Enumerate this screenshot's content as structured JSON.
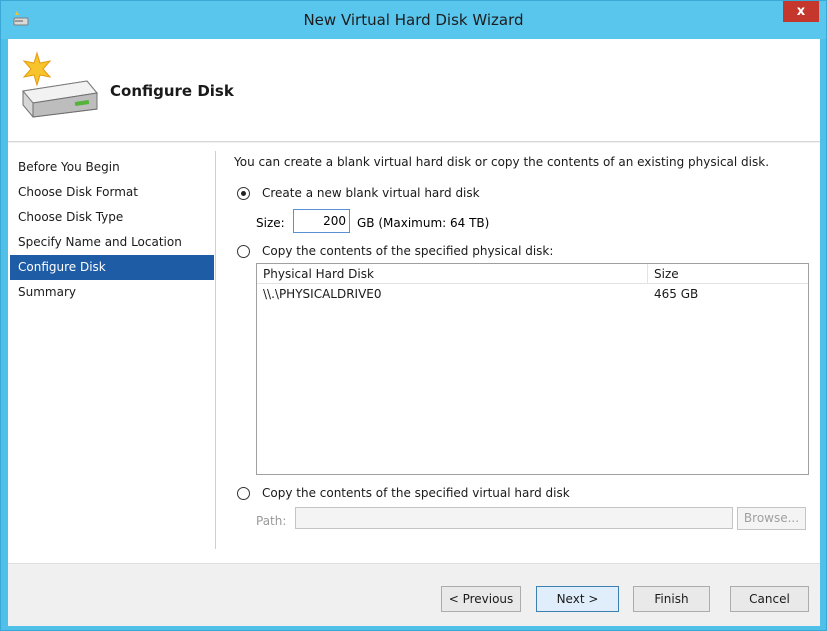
{
  "window": {
    "title": "New Virtual Hard Disk Wizard",
    "close_label": "x"
  },
  "header": {
    "title": "Configure Disk"
  },
  "steps": [
    {
      "label": "Before You Begin",
      "active": false
    },
    {
      "label": "Choose Disk Format",
      "active": false
    },
    {
      "label": "Choose Disk Type",
      "active": false
    },
    {
      "label": "Specify Name and Location",
      "active": false
    },
    {
      "label": "Configure Disk",
      "active": true
    },
    {
      "label": "Summary",
      "active": false
    }
  ],
  "main": {
    "intro": "You can create a blank virtual hard disk or copy the contents of an existing physical disk.",
    "option_new": {
      "label": "Create a new blank virtual hard disk",
      "selected": true,
      "size_label": "Size:",
      "size_value": "200",
      "size_unit": "GB (Maximum: 64 TB)"
    },
    "option_physical": {
      "label": "Copy the contents of the specified physical disk:",
      "selected": false,
      "table": {
        "columns": [
          "Physical Hard Disk",
          "Size"
        ],
        "rows": [
          [
            "\\\\.\\PHYSICALDRIVE0",
            "465 GB"
          ]
        ]
      }
    },
    "option_virtual": {
      "label": "Copy the contents of the specified virtual hard disk",
      "selected": false,
      "path_label": "Path:",
      "path_value": "",
      "browse_label": "Browse..."
    }
  },
  "footer": {
    "previous_label": "< Previous",
    "next_label": "Next >",
    "finish_label": "Finish",
    "cancel_label": "Cancel"
  },
  "colors": {
    "title_bar": "#59c6ee",
    "active_step": "#1e5ca6",
    "close_button": "#c5372c"
  }
}
